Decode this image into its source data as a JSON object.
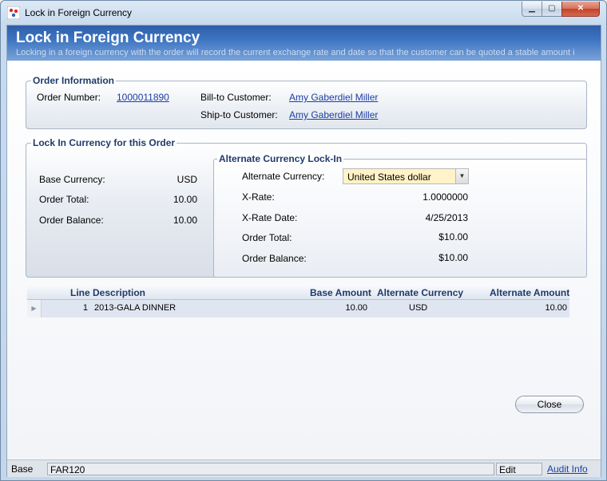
{
  "window": {
    "title": "Lock in Foreign Currency",
    "controls": {
      "minimize": "▁",
      "maximize": "▢",
      "close": "✕"
    }
  },
  "header": {
    "title": "Lock in Foreign Currency",
    "subtitle": "Locking in a foreign currency with the order will record the current exchange rate and date so that the customer can be quoted a stable amount i"
  },
  "order_info": {
    "legend": "Order Information",
    "order_number_label": "Order Number:",
    "order_number": "1000011890",
    "bill_to_label": "Bill-to Customer:",
    "bill_to": "Amy Gaberdiel Miller",
    "ship_to_label": "Ship-to Customer:",
    "ship_to": "Amy Gaberdiel Miller"
  },
  "lock_in": {
    "legend": "Lock In Currency for this Order",
    "base_currency_label": "Base Currency:",
    "base_currency": "USD",
    "order_total_label": "Order Total:",
    "order_total": "10.00",
    "order_balance_label": "Order Balance:",
    "order_balance": "10.00"
  },
  "alternate": {
    "legend": "Alternate Currency Lock-In",
    "currency_label": "Alternate Currency:",
    "currency_value": "United States dollar",
    "xrate_label": "X-Rate:",
    "xrate": "1.0000000",
    "xrate_date_label": "X-Rate Date:",
    "xrate_date": "4/25/2013",
    "order_total_label": "Order Total:",
    "order_total": "$10.00",
    "order_balance_label": "Order Balance:",
    "order_balance": "$10.00"
  },
  "grid": {
    "columns": {
      "line": "Line",
      "description": "Description",
      "base_amount": "Base Amount",
      "alternate_currency": "Alternate Currency",
      "alternate_amount": "Alternate Amount"
    },
    "rows": [
      {
        "line": "1",
        "description": "2013-GALA DINNER",
        "base_amount": "10.00",
        "alternate_currency": "USD",
        "alternate_amount": "10.00"
      }
    ]
  },
  "buttons": {
    "close": "Close"
  },
  "status": {
    "base": "Base",
    "form_code": "FAR120",
    "mode": "Edit",
    "audit_info": "Audit Info"
  }
}
